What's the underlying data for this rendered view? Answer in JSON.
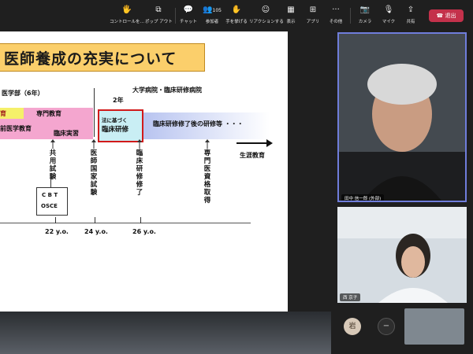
{
  "toolbar": {
    "items": [
      {
        "label": "コントロールを…",
        "icon": "🖐"
      },
      {
        "label": "ポップ アウト",
        "icon": "⧉"
      },
      {
        "label": "チャット",
        "icon": "💬"
      },
      {
        "label": "参加者",
        "icon": "👥",
        "count": "105"
      },
      {
        "label": "手を挙げる",
        "icon": "✋"
      },
      {
        "label": "リアクションする",
        "icon": "☺"
      },
      {
        "label": "表示",
        "icon": "▦"
      },
      {
        "label": "アプリ",
        "icon": "⊞"
      },
      {
        "label": "その他",
        "icon": "···"
      },
      {
        "label": "カメラ",
        "icon": "📷"
      },
      {
        "label": "マイク",
        "icon": "🎙"
      },
      {
        "label": "共有",
        "icon": "⇪"
      }
    ],
    "leave_label": "退出"
  },
  "slide": {
    "title": "医師養成の充実について",
    "faculty": "医学部（6年）",
    "hospital": "大学病院・臨床研修病院",
    "years2": "2年",
    "edu_prefix": "育",
    "specialized": "専門教育",
    "pre_clinical": "前医学教育",
    "clinical_practice": "臨床実習",
    "box_small": "法に基づく",
    "box_main": "臨床研修",
    "after_training": "臨床研修修了後の研修等 ・・・",
    "lifelong": "生涯教育",
    "kyoyo": "共用試験",
    "kokka": "医師国家試験",
    "shuryo": "臨床研修修了",
    "senmon": "専門医資格取得",
    "cbt1": "C B T",
    "cbt2": "OSCE",
    "age22": "22 y.o.",
    "age24": "24 y.o.",
    "age26": "26 y.o."
  },
  "participants": [
    {
      "name": "田中 信一郎 (外部)"
    },
    {
      "name": "西 京子"
    }
  ],
  "self": {
    "initial": "岩"
  },
  "colors": {
    "leave": "#c4314b",
    "active_border": "#6f7ddb",
    "title_bg": "#fbcf6b"
  }
}
